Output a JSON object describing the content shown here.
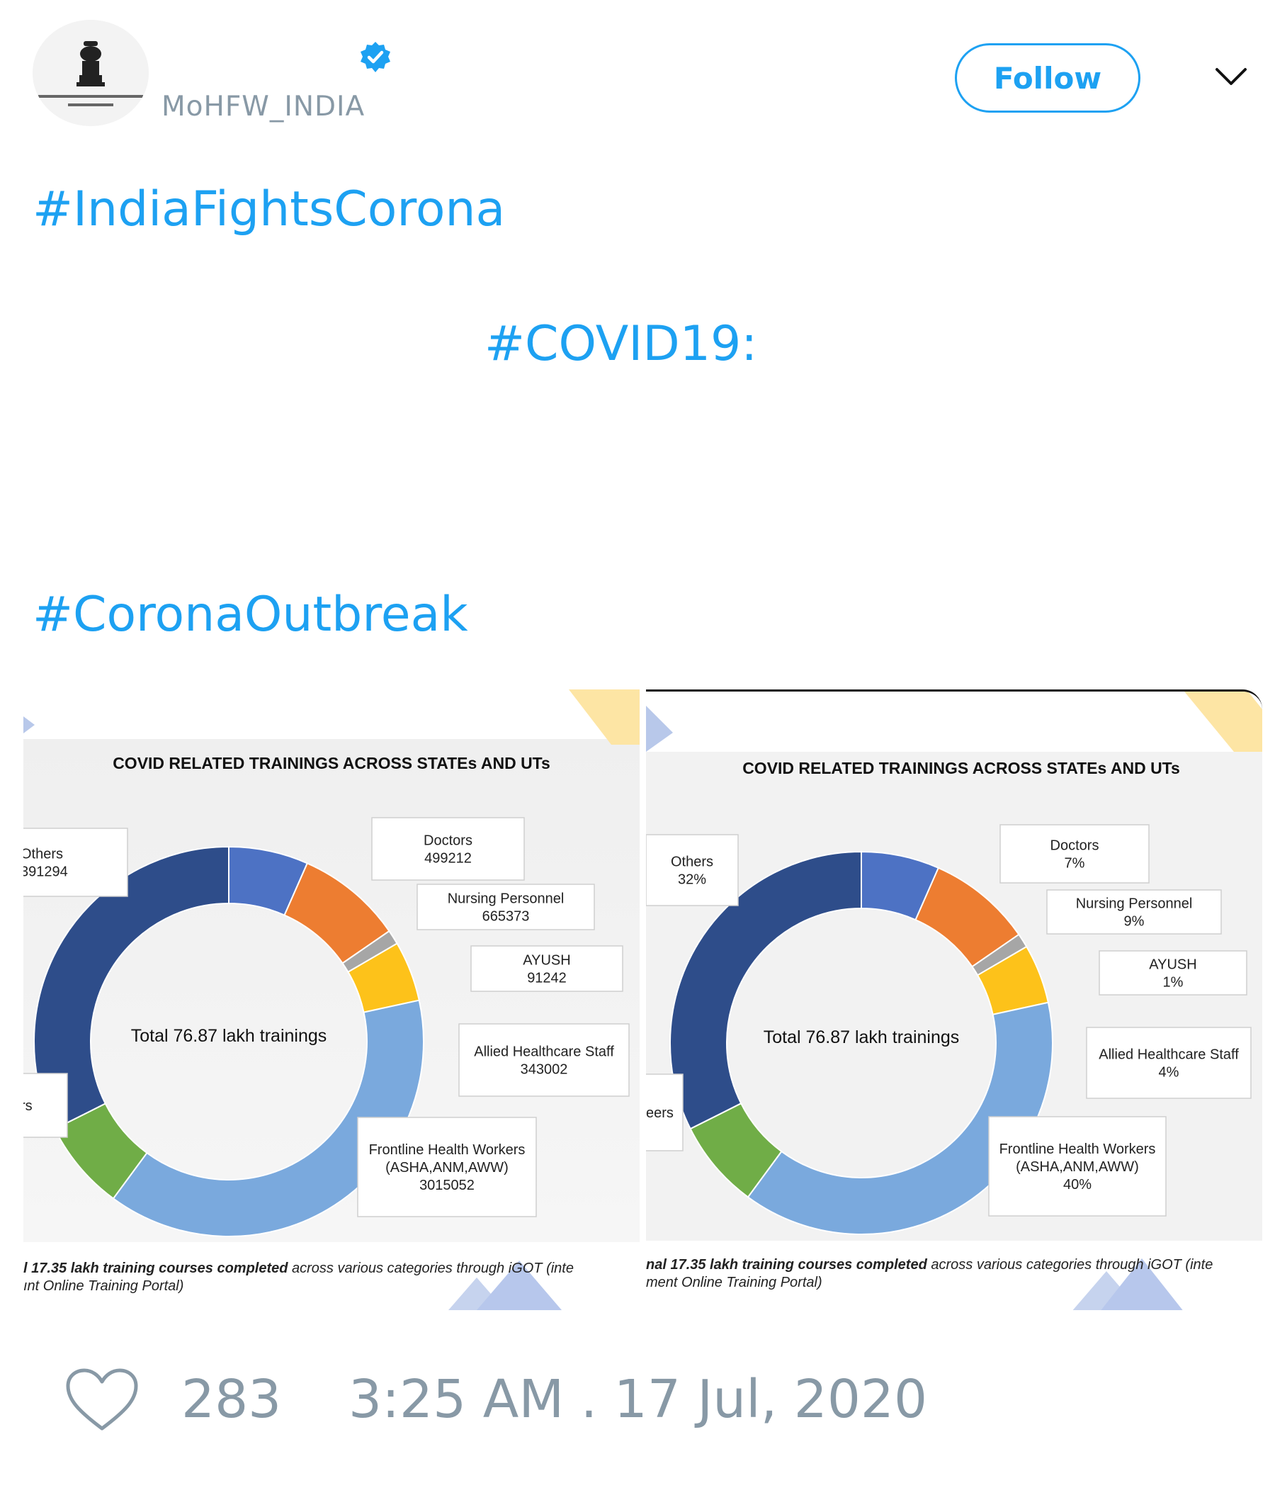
{
  "tweet": {
    "author_handle": "MoHFW_INDIA",
    "follow_label": "Follow",
    "hashtags": [
      "#IndiaFightsCorona",
      "#COVID19:",
      "#CoronaOutbreak"
    ],
    "likes": "283",
    "timestamp": "3:25 AM . 17 Jul, 2020",
    "icons": [
      "emblem-avatar-icon",
      "verified-badge-icon",
      "chevron-down-icon",
      "heart-icon"
    ],
    "accent_color": "#1da1f2",
    "muted_color": "#8899a6"
  },
  "images": [
    {
      "title": "COVID RELATED TRAININGS ACROSS STATEs AND UTs",
      "center_label": "Total 76.87 lakh trainings",
      "footer_bold": "l 17.35 lakh training courses completed",
      "footer_rest": " across various categories through iGOT (inte",
      "footer_line2": "ınt Online Training Portal)",
      "callouts": [
        {
          "name": "Others",
          "value": "391294"
        },
        {
          "name": "Doctors",
          "value": "499212"
        },
        {
          "name": "Nursing Personnel",
          "value": "665373"
        },
        {
          "name": "AYUSH",
          "value": "91242"
        },
        {
          "name": "Allied Healthcare Staff",
          "value": "343002"
        },
        {
          "name": "Frontline Health Workers",
          "sub": "(ASHA,ANM,AWW)",
          "value": "3015052"
        },
        {
          "name": "rs",
          "value": ""
        }
      ]
    },
    {
      "title": "COVID RELATED TRAININGS ACROSS STATEs AND UTs",
      "center_label": "Total 76.87 lakh trainings",
      "footer_bold": "nal 17.35 lakh training courses completed",
      "footer_rest": " across various categories through iGOT (inte",
      "footer_line2": "ment Online Training Portal)",
      "callouts": [
        {
          "name": "Others",
          "value": "32%"
        },
        {
          "name": "Doctors",
          "value": "7%"
        },
        {
          "name": "Nursing Personnel",
          "value": "9%"
        },
        {
          "name": "AYUSH",
          "value": "1%"
        },
        {
          "name": "Allied Healthcare Staff",
          "value": "4%"
        },
        {
          "name": "Frontline Health Workers",
          "sub": "(ASHA,ANM,AWW)",
          "value": "40%"
        },
        {
          "name": "eers",
          "value": ""
        }
      ]
    }
  ],
  "chart_data": [
    {
      "type": "pie",
      "title": "COVID RELATED TRAININGS ACROSS STATEs AND UTs",
      "subtitle": "Total 76.87 lakh trainings",
      "categories": [
        "Doctors",
        "Nursing Personnel",
        "(unlabeled grey)",
        "AYUSH",
        "Allied Healthcare Staff",
        "Frontline Health Workers (ASHA,ANM,AWW)",
        "(unlabeled green)",
        "Others"
      ],
      "values": [
        0.066,
        0.088,
        0.012,
        0.05,
        0.0,
        0.385,
        0.075,
        0.324
      ],
      "colors": [
        "#4d72c4",
        "#ed7d31",
        "#a6a6a6",
        "#fdc21a",
        "#5b9bd5",
        "#7aa9dd",
        "#70ad47",
        "#2e4d8a"
      ],
      "donut": true
    }
  ]
}
